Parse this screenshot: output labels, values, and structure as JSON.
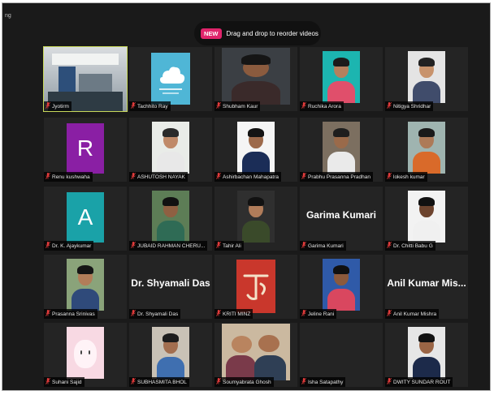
{
  "window": {
    "corner_label": "ng"
  },
  "banner": {
    "badge": "NEW",
    "text": "Drag and drop to reorder videos"
  },
  "colors": {
    "badge": "#e0246b",
    "active_outline": "#c8d85a",
    "tile_bg": "#242424"
  },
  "participants": [
    {
      "name": "Jyotirm",
      "type": "video",
      "scene": "room",
      "active": true
    },
    {
      "name": "Tachhito Ray",
      "type": "logo"
    },
    {
      "name": "Shubham Kaur",
      "type": "video",
      "scene": "woman-dark"
    },
    {
      "name": "Ruchika Arora",
      "type": "video",
      "scene": "woman-pink"
    },
    {
      "name": "Nitigya Shridhar",
      "type": "video",
      "scene": "woman-glasses"
    },
    {
      "name": "Renu kushwaha",
      "type": "letter",
      "letter": "R"
    },
    {
      "name": "ASHUTOSH NAYAK",
      "type": "video",
      "scene": "man-light"
    },
    {
      "name": "Ashirbachan Mahapatra",
      "type": "video",
      "scene": "man-formal"
    },
    {
      "name": "Prabhu Prasanna Pradhan",
      "type": "video",
      "scene": "man-outdoor"
    },
    {
      "name": "lokesh kumar",
      "type": "video",
      "scene": "man-orange"
    },
    {
      "name": "Dr. K. Ajaykumar",
      "type": "letter",
      "letter": "A"
    },
    {
      "name": "JUBAID RAHMAN CHERU...",
      "type": "video",
      "scene": "man-green"
    },
    {
      "name": "Tahir Ali",
      "type": "video",
      "scene": "man-beard"
    },
    {
      "name": "Garima Kumari",
      "type": "name",
      "display": "Garima Kumari"
    },
    {
      "name": "Dr. Chitti Babu G",
      "type": "video",
      "scene": "man-smile"
    },
    {
      "name": "Prasanna Srinivas",
      "type": "video",
      "scene": "man-park"
    },
    {
      "name": "Dr. Shyamali Das",
      "type": "name",
      "display": "Dr. Shyamali Das"
    },
    {
      "name": "KRITI MINZ",
      "type": "art"
    },
    {
      "name": "Jeline Rani",
      "type": "video",
      "scene": "woman-blue"
    },
    {
      "name": "Anil Kumar Mishra",
      "type": "name",
      "display": "Anil Kumar Mis..."
    },
    {
      "name": "Suhani Sajid",
      "type": "video",
      "scene": "cartoon"
    },
    {
      "name": "SUBHASMITA BHOL",
      "type": "video",
      "scene": "woman-room"
    },
    {
      "name": "Soumyabrata Ghosh",
      "type": "video",
      "scene": "couple"
    },
    {
      "name": "Isha Satapathy",
      "type": "blank"
    },
    {
      "name": "DWITY SUNDAR ROUT",
      "type": "video",
      "scene": "man-suit"
    }
  ]
}
